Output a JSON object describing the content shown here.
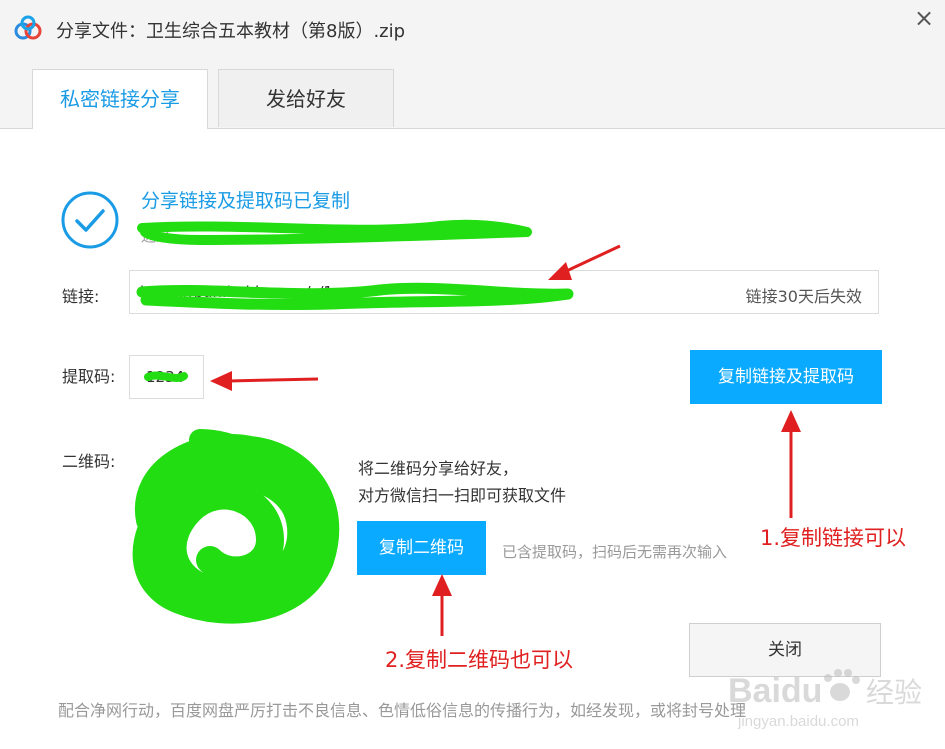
{
  "window": {
    "title": "分享文件：卫生综合五本教材（第8版）.zip",
    "close_glyph": "×",
    "logo_icon": "baidu-netdisk-logo-icon"
  },
  "tabs": [
    {
      "label": "私密链接分享",
      "active": true
    },
    {
      "label": "发给好友",
      "active": false
    }
  ],
  "success": {
    "message": "分享链接及提取码已复制",
    "sub": "通过"
  },
  "link_row": {
    "label": "链接:",
    "value": "https://pan.baidu.com/s/1",
    "expire_note": "链接30天后失效"
  },
  "code_row": {
    "label": "提取码:",
    "value": "1234"
  },
  "buttons": {
    "copy_link": "复制链接及提取码",
    "copy_qr": "复制二维码",
    "close": "关闭"
  },
  "qr": {
    "label": "二维码:",
    "desc_line1": "将二维码分享给好友，",
    "desc_line2": "对方微信扫一扫即可获取文件",
    "note": "已含提取码，扫码后无需再次输入"
  },
  "footer": {
    "note": "配合净网行动，百度网盘严厉打击不良信息、色情低俗信息的传播行为，如经发现，或将封号处理"
  },
  "annotations": {
    "step1": "1.复制链接可以",
    "step2": "2.复制二维码也可以",
    "color": "#e02020"
  },
  "redaction_color": "#22dd11",
  "accent_color": "#09aaff",
  "watermark": {
    "brand": "Baidu",
    "brand_cn": "经验",
    "url": "jingyan.baidu.com"
  }
}
